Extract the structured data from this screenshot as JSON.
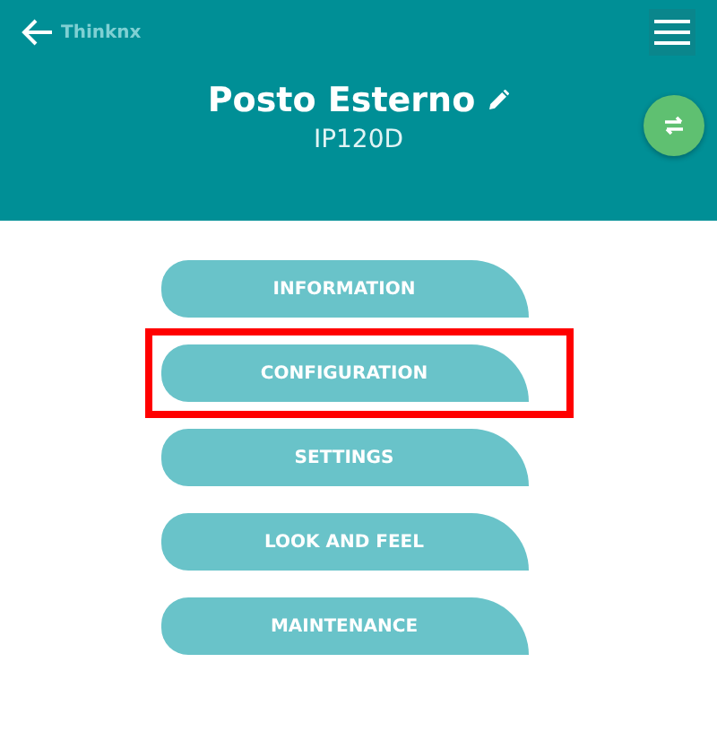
{
  "header": {
    "back_label": "Thinknx",
    "title": "Posto Esterno",
    "subtitle": "IP120D"
  },
  "menu": [
    {
      "label": "INFORMATION",
      "highlighted": false
    },
    {
      "label": "CONFIGURATION",
      "highlighted": true
    },
    {
      "label": "SETTINGS",
      "highlighted": false
    },
    {
      "label": "LOOK AND FEEL",
      "highlighted": false
    },
    {
      "label": "MAINTENANCE",
      "highlighted": false
    }
  ]
}
